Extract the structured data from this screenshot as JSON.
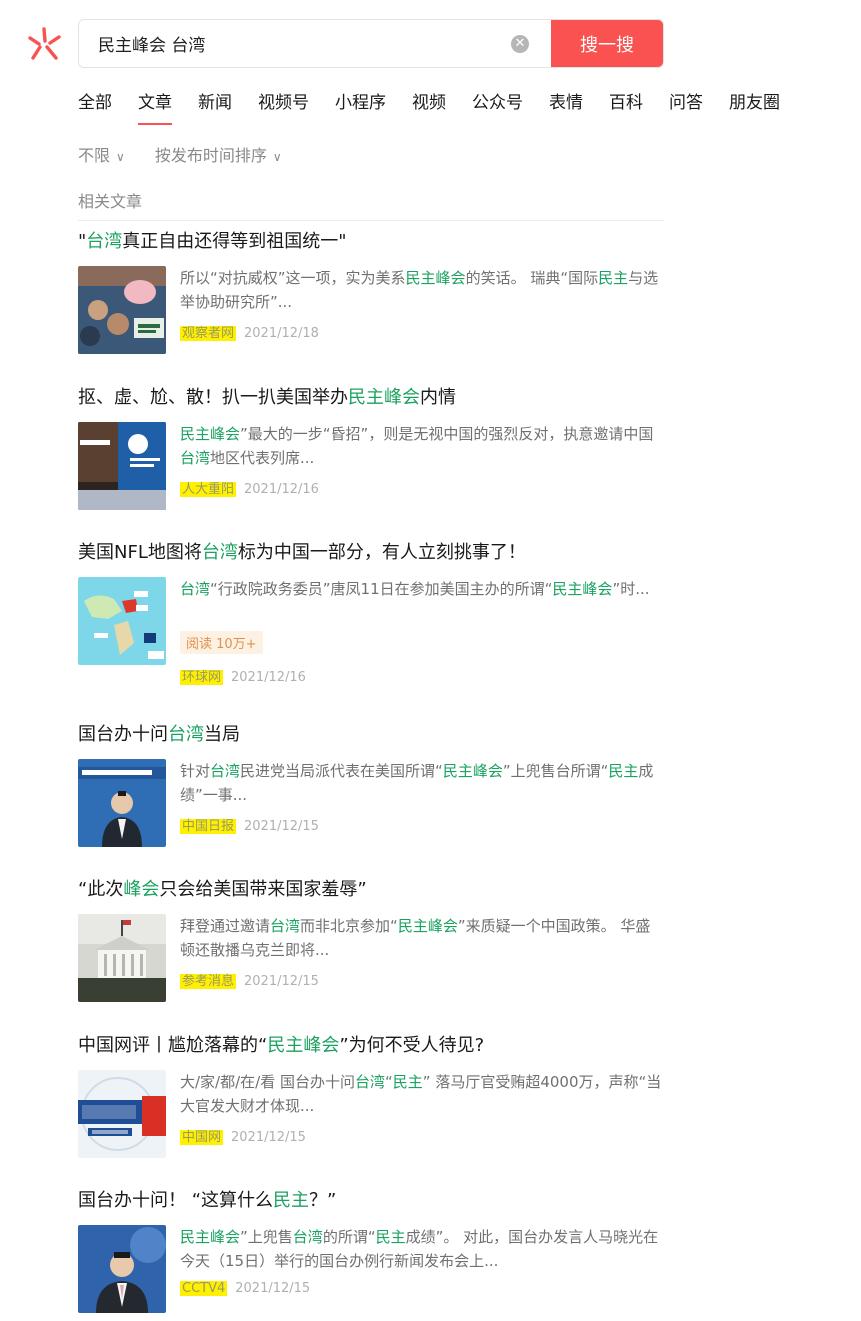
{
  "search": {
    "query": "民主峰会 台湾",
    "clear_icon": "close-circle-icon",
    "button_label": "搜一搜"
  },
  "tabs": [
    "全部",
    "文章",
    "新闻",
    "视频号",
    "小程序",
    "视频",
    "公众号",
    "表情",
    "百科",
    "问答",
    "朋友圈"
  ],
  "active_tab": "文章",
  "filters": {
    "time": "不限",
    "sort": "按发布时间排序"
  },
  "section_title": "相关文章",
  "colors": {
    "accent": "#fa5151",
    "highlight": "#1aa260",
    "source_marker": "#fff000"
  },
  "results": [
    {
      "title": [
        [
          "\"",
          false
        ],
        [
          "台湾",
          true
        ],
        [
          "真正自由还得等到祖国统一\"",
          false
        ]
      ],
      "snippet": [
        [
          "所以“对抗威权”这一项，实为美系",
          false
        ],
        [
          "民主峰会",
          true
        ],
        [
          "的笑话。 瑞典“国际",
          false
        ],
        [
          "民主",
          true
        ],
        [
          "与选举协助研究所”...",
          false
        ]
      ],
      "source": "观察者网",
      "date": "2021/12/18"
    },
    {
      "title": [
        [
          "抠、虚、尬、散！扒一扒美国举办",
          false
        ],
        [
          "民主峰会",
          true
        ],
        [
          "内情",
          false
        ]
      ],
      "snippet": [
        [
          "民主峰会",
          true
        ],
        [
          "”最大的一步“昏招”，则是无视中国的强烈反对，执意邀请中国",
          false
        ],
        [
          "台湾",
          true
        ],
        [
          "地区代表列席...",
          false
        ]
      ],
      "source": "人大重阳",
      "date": "2021/12/16"
    },
    {
      "title": [
        [
          "美国NFL地图将",
          false
        ],
        [
          "台湾",
          true
        ],
        [
          "标为中国一部分，有人立刻挑事了！",
          false
        ]
      ],
      "snippet": [
        [
          "台湾",
          true
        ],
        [
          "“行政院政务委员”唐凤11日在参加美国主办的所谓“",
          false
        ],
        [
          "民主峰会",
          true
        ],
        [
          "”时...",
          false
        ]
      ],
      "read_badge": "阅读 10万+",
      "source": "环球网",
      "date": "2021/12/16"
    },
    {
      "title": [
        [
          "国台办十问",
          false
        ],
        [
          "台湾",
          true
        ],
        [
          "当局",
          false
        ]
      ],
      "snippet": [
        [
          "针对",
          false
        ],
        [
          "台湾",
          true
        ],
        [
          "民进党当局派代表在美国所谓“",
          false
        ],
        [
          "民主峰会",
          true
        ],
        [
          "”上兜售台所谓“",
          false
        ],
        [
          "民主",
          true
        ],
        [
          "成绩”一事...",
          false
        ]
      ],
      "source": "中国日报",
      "date": "2021/12/15"
    },
    {
      "title": [
        [
          "“此次",
          false
        ],
        [
          "峰会",
          true
        ],
        [
          "只会给美国带来国家羞辱”",
          false
        ]
      ],
      "snippet": [
        [
          "拜登通过邀请",
          false
        ],
        [
          "台湾",
          true
        ],
        [
          "而非北京参加“",
          false
        ],
        [
          "民主峰会",
          true
        ],
        [
          "”来质疑一个中国政策。 华盛顿还散播乌克兰即将...",
          false
        ]
      ],
      "source": "参考消息",
      "date": "2021/12/15"
    },
    {
      "title": [
        [
          "中国网评丨尴尬落幕的“",
          false
        ],
        [
          "民主峰会",
          true
        ],
        [
          "”为何不受人待见?",
          false
        ]
      ],
      "snippet": [
        [
          "大/家/都/在/看 国台办十问",
          false
        ],
        [
          "台湾",
          true
        ],
        [
          "“",
          false
        ],
        [
          "民主",
          true
        ],
        [
          "” 落马厅官受贿超4000万，声称“当大官发大财才体现...",
          false
        ]
      ],
      "source": "中国网",
      "date": "2021/12/15"
    },
    {
      "title": [
        [
          "国台办十问！ “这算什么",
          false
        ],
        [
          "民主",
          true
        ],
        [
          "？”",
          false
        ]
      ],
      "snippet": [
        [
          "民主峰会",
          true
        ],
        [
          "”上兜售",
          false
        ],
        [
          "台湾",
          true
        ],
        [
          "的所谓“",
          false
        ],
        [
          "民主",
          true
        ],
        [
          "成绩”。 对此，国台办发言人马晓光在今天（15日）举行的国台办例行新闻发布会上...",
          false
        ]
      ],
      "source": "CCTV4",
      "date": "2021/12/15"
    }
  ]
}
